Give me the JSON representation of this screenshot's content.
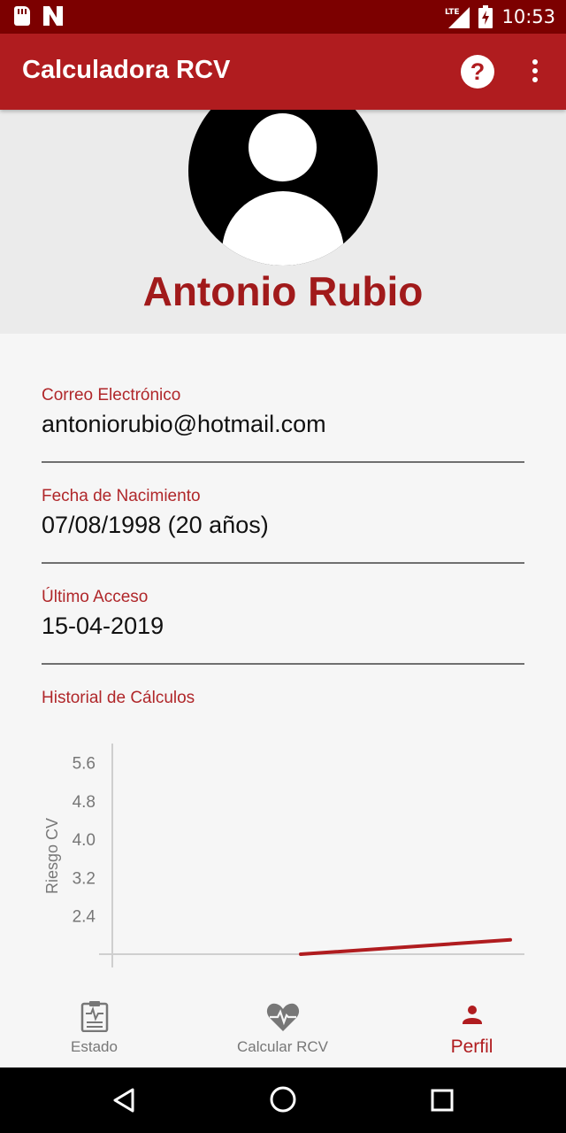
{
  "status_bar": {
    "time": "10:53",
    "network": "LTE",
    "icons": [
      "sd-card-icon",
      "n-notification-icon",
      "lte-signal-icon",
      "battery-charging-icon"
    ]
  },
  "app_bar": {
    "title": "Calculadora RCV",
    "help_icon": "question-circle-icon",
    "help_glyph": "?",
    "menu_icon": "more-vert-icon"
  },
  "profile": {
    "name": "Antonio Rubio",
    "avatar_icon": "user-avatar-icon"
  },
  "fields": {
    "email": {
      "label": "Correo Electrónico",
      "value": "antoniorubio@hotmail.com"
    },
    "birth": {
      "label": "Fecha de Nacimiento",
      "value": "07/08/1998 (20 años)"
    },
    "last_access": {
      "label": "Último Acceso",
      "value": "15-04-2019"
    },
    "history": {
      "label": "Historial de Cálculos"
    }
  },
  "chart_data": {
    "type": "line",
    "title": "",
    "xlabel": "",
    "ylabel": "Riesgo CV",
    "yticks": [
      "5.6",
      "4.8",
      "4.0",
      "3.2",
      "2.4"
    ],
    "ylim": [
      1.6,
      6.0
    ],
    "grid": false,
    "legend": "none",
    "series": [
      {
        "color": "#b01c1f",
        "x": [
          0,
          1
        ],
        "y": [
          1.6,
          1.9
        ]
      }
    ]
  },
  "bottom_nav": {
    "items": [
      {
        "label": "Estado",
        "icon": "clipboard-icon",
        "active": false
      },
      {
        "label": "Calcular RCV",
        "icon": "heartbeat-icon",
        "active": false
      },
      {
        "label": "Perfil",
        "icon": "person-icon",
        "active": true
      }
    ]
  },
  "colors": {
    "status_bar": "#7c0000",
    "app_bar": "#b01c1f",
    "accent_text": "#b0272a",
    "name": "#a11a1b",
    "line": "#b01c1f"
  }
}
